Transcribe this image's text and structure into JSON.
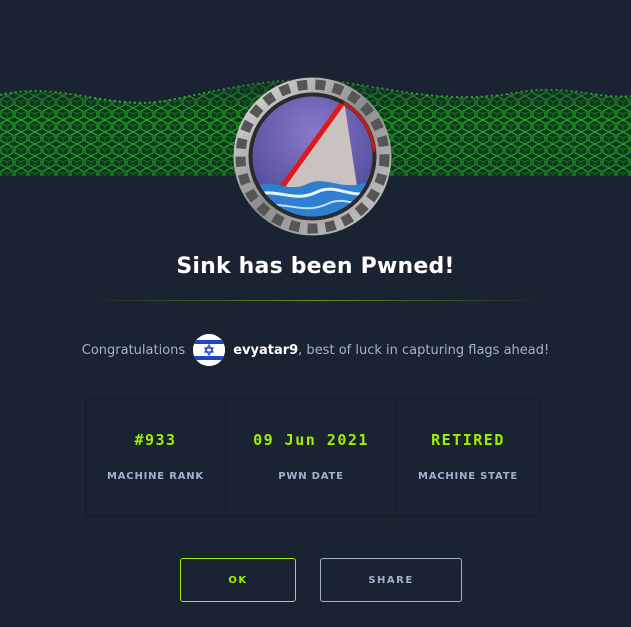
{
  "modal": {
    "title": "Sink has been Pwned!",
    "congrats_lead": "Congratulations",
    "username": "evyatar9",
    "congrats_tail": ", best of luck in capturing flags ahead!",
    "user_flag_icon": "israel-flag-icon",
    "machine_badge_icon": "sinking-ship-badge-icon"
  },
  "stats": [
    {
      "value": "#933",
      "label": "MACHINE RANK"
    },
    {
      "value": "09 Jun 2021",
      "label": "PWN DATE"
    },
    {
      "value": "RETIRED",
      "label": "MACHINE STATE"
    }
  ],
  "buttons": {
    "ok": "OK",
    "share": "SHARE"
  },
  "colors": {
    "background": "#1a2332",
    "accent": "#9fef00",
    "muted": "#a4b1cd"
  }
}
